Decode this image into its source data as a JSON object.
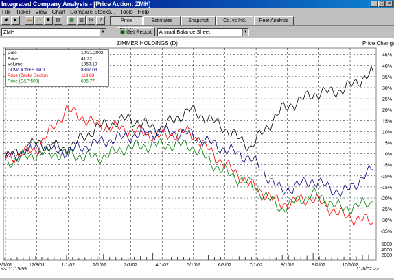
{
  "window": {
    "title": "Integrated Company Analysis - [Price Action:  ZMH]",
    "buttons": [
      "_",
      "□",
      "×"
    ]
  },
  "menu": [
    "File",
    "Ticker",
    "View",
    "Chart",
    "Compare Stocks...",
    "Tools",
    "Help"
  ],
  "toolbar": {
    "icons": [
      "back-arrow-icon",
      "forward-arrow-icon",
      "open-folder-icon",
      "open-icon",
      "save-icon",
      "print-icon",
      "grid-icon",
      "report-icon",
      "zoom-icon",
      "help-icon"
    ],
    "tabs": [
      "Price Action",
      "Estimates",
      "Snapshot",
      "Co. vs Ind.",
      "Peer Analysis"
    ],
    "active_tab": "Price Action"
  },
  "controls": {
    "ticker": "ZMH",
    "get_report": "Get Report",
    "report_type": "Annual Balance Sheet"
  },
  "chart": {
    "company_title": "ZIMMER HOLDINGS (D)",
    "right_title": "Price Change",
    "info": [
      {
        "label": "Date",
        "value": "10/31/2002",
        "color": "#000000"
      },
      {
        "label": "Price",
        "value": "41.22",
        "color": "#000000"
      },
      {
        "label": "Volume",
        "value": "1369.10",
        "color": "#000000"
      },
      {
        "label": "DOW JONES INDL",
        "value": "8397.03",
        "color": "#000080"
      },
      {
        "label": "Price (Zacks Sector)",
        "value": "119.83",
        "color": "#ff0000"
      },
      {
        "label": "Price (S&P 500)",
        "value": "885.77",
        "color": "#008000"
      }
    ],
    "x_ticks": [
      "8/1/01",
      "12/3/01",
      "1/1/02",
      "2/1/02",
      "3/1/02",
      "4/1/02",
      "5/1/02",
      "6/3/02",
      "7/1/02",
      "8/1/02",
      "9/2/02",
      "10/1/02"
    ],
    "x_footer_left": "<< 11/15/99",
    "x_footer_right": "11/8/02 >>",
    "y_price_ticks": [
      "45%",
      "40%",
      "35%",
      "30%",
      "25%",
      "20%",
      "15%",
      "10%",
      "5%",
      "0%",
      "-5%",
      "-10%",
      "-15%",
      "-20%",
      "-25%",
      "-30%",
      "-35%"
    ],
    "y_volume_ticks": [
      "6000",
      "4000",
      "2000"
    ]
  },
  "chart_data": {
    "type": "line",
    "title": "ZIMMER HOLDINGS (D)",
    "ylabel": "Price Change",
    "ylim": [
      -38,
      48
    ],
    "x": [
      "8/1/01",
      "12/3/01",
      "1/1/02",
      "2/1/02",
      "3/1/02",
      "4/1/02",
      "5/1/02",
      "6/3/02",
      "7/1/02",
      "8/1/02",
      "9/2/02",
      "10/1/02",
      "11/8/02"
    ],
    "series": [
      {
        "name": "ZIMMER HOLDINGS",
        "color": "#000000",
        "values": [
          -2,
          5,
          2,
          12,
          16,
          11,
          20,
          13,
          3,
          20,
          27,
          29,
          37
        ]
      },
      {
        "name": "DOW JONES INDL",
        "color": "#000080",
        "values": [
          -2,
          3,
          1,
          5,
          8,
          10,
          9,
          3,
          -2,
          -17,
          -12,
          -18,
          -7
        ]
      },
      {
        "name": "Price (Zacks Sector)",
        "color": "#ff0000",
        "values": [
          -2,
          2,
          20,
          13,
          11,
          8,
          10,
          -3,
          -14,
          -23,
          -20,
          -28,
          -31
        ]
      },
      {
        "name": "Price (S&P 500)",
        "color": "#008000",
        "values": [
          -4,
          0,
          0,
          -2,
          3,
          4,
          4,
          -7,
          -14,
          -25,
          -18,
          -25,
          -22
        ]
      }
    ],
    "volume": {
      "ylim": [
        0,
        7000
      ],
      "values": [
        900,
        700,
        1100,
        800,
        1300,
        1500,
        1000,
        800,
        1200,
        900,
        1700,
        1000,
        800,
        900,
        1100,
        1400,
        2200,
        1200,
        1000,
        900,
        800,
        1300,
        1500,
        1100,
        2600,
        1200,
        900,
        1000,
        1200,
        1100,
        800,
        1000,
        1500,
        1900,
        1200,
        1100,
        900,
        1600,
        1400,
        1000,
        1200,
        800,
        1100,
        1300,
        900,
        2000,
        1700,
        1300,
        1100,
        1600,
        2500,
        1400,
        1100,
        900,
        1200,
        1300,
        1000,
        1400,
        1800,
        2100
      ]
    }
  }
}
